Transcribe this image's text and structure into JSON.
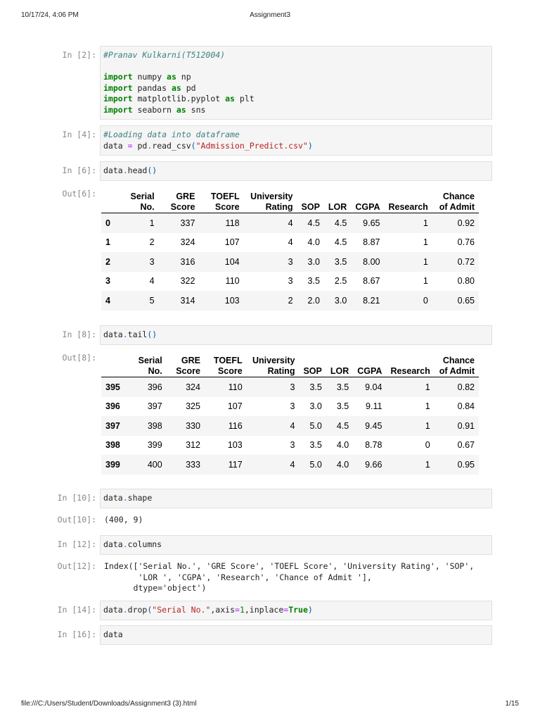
{
  "header": {
    "datetime": "10/17/24, 4:06 PM",
    "title": "Assignment3"
  },
  "footer": {
    "path": "file:///C:/Users/Student/Downloads/Assignment3 (3).html",
    "page": "1/15"
  },
  "cells": [
    {
      "prompt": "In [2]:",
      "code": [
        [
          [
            "#Pranav Kulkarni(T512004)",
            "cm"
          ]
        ],
        [],
        [
          [
            "import",
            "kw"
          ],
          [
            " numpy ",
            ""
          ],
          [
            "as",
            "kw"
          ],
          [
            " np",
            ""
          ]
        ],
        [
          [
            "import",
            "kw"
          ],
          [
            " pandas ",
            ""
          ],
          [
            "as",
            "kw"
          ],
          [
            " pd",
            ""
          ]
        ],
        [
          [
            "import",
            "kw"
          ],
          [
            " matplotlib.pyplot ",
            ""
          ],
          [
            "as",
            "kw"
          ],
          [
            " plt",
            ""
          ]
        ],
        [
          [
            "import",
            "kw"
          ],
          [
            " seaborn ",
            ""
          ],
          [
            "as",
            "kw"
          ],
          [
            " sns",
            ""
          ]
        ]
      ]
    },
    {
      "prompt": "In [4]:",
      "code": [
        [
          [
            "#Loading data into dataframe",
            "cm"
          ]
        ],
        [
          [
            "data ",
            ""
          ],
          [
            "=",
            "op"
          ],
          [
            " pd",
            ""
          ],
          [
            ".",
            "op"
          ],
          [
            "read_csv",
            ""
          ],
          [
            "(",
            "pn"
          ],
          [
            "\"Admission_Predict.csv\"",
            "st"
          ],
          [
            ")",
            "pn"
          ]
        ]
      ]
    },
    {
      "prompt": "In [6]:",
      "code": [
        [
          [
            "data",
            ""
          ],
          [
            ".",
            "op"
          ],
          [
            "head",
            ""
          ],
          [
            "()",
            "pn"
          ]
        ]
      ]
    },
    {
      "prompt": "In [8]:",
      "code": [
        [
          [
            "data",
            ""
          ],
          [
            ".",
            "op"
          ],
          [
            "tail",
            ""
          ],
          [
            "()",
            "pn"
          ]
        ]
      ]
    },
    {
      "prompt": "In [10]:",
      "code": [
        [
          [
            "data",
            ""
          ],
          [
            ".",
            "op"
          ],
          [
            "shape",
            ""
          ]
        ]
      ]
    },
    {
      "prompt": "In [12]:",
      "code": [
        [
          [
            "data",
            ""
          ],
          [
            ".",
            "op"
          ],
          [
            "columns",
            ""
          ]
        ]
      ]
    },
    {
      "prompt": "In [14]:",
      "code": [
        [
          [
            "data",
            ""
          ],
          [
            ".",
            "op"
          ],
          [
            "drop",
            ""
          ],
          [
            "(",
            "pn"
          ],
          [
            "\"Serial No.\"",
            "st"
          ],
          [
            ",axis",
            ""
          ],
          [
            "=",
            "op"
          ],
          [
            "1",
            "nu"
          ],
          [
            ",inplace",
            ""
          ],
          [
            "=",
            "op"
          ],
          [
            "True",
            "kw"
          ],
          [
            ")",
            "pn"
          ]
        ]
      ]
    },
    {
      "prompt": "In [16]:",
      "code": [
        [
          [
            "data",
            ""
          ]
        ]
      ]
    }
  ],
  "outputs": {
    "out6": {
      "prompt": "Out[6]:",
      "columns": [
        "",
        "Serial No.",
        "GRE Score",
        "TOEFL Score",
        "University Rating",
        "SOP",
        "LOR",
        "CGPA",
        "Research",
        "Chance of Admit"
      ],
      "rows": [
        [
          "0",
          "1",
          "337",
          "118",
          "4",
          "4.5",
          "4.5",
          "9.65",
          "1",
          "0.92"
        ],
        [
          "1",
          "2",
          "324",
          "107",
          "4",
          "4.0",
          "4.5",
          "8.87",
          "1",
          "0.76"
        ],
        [
          "2",
          "3",
          "316",
          "104",
          "3",
          "3.0",
          "3.5",
          "8.00",
          "1",
          "0.72"
        ],
        [
          "3",
          "4",
          "322",
          "110",
          "3",
          "3.5",
          "2.5",
          "8.67",
          "1",
          "0.80"
        ],
        [
          "4",
          "5",
          "314",
          "103",
          "2",
          "2.0",
          "3.0",
          "8.21",
          "0",
          "0.65"
        ]
      ]
    },
    "out8": {
      "prompt": "Out[8]:",
      "columns": [
        "",
        "Serial No.",
        "GRE Score",
        "TOEFL Score",
        "University Rating",
        "SOP",
        "LOR",
        "CGPA",
        "Research",
        "Chance of Admit"
      ],
      "rows": [
        [
          "395",
          "396",
          "324",
          "110",
          "3",
          "3.5",
          "3.5",
          "9.04",
          "1",
          "0.82"
        ],
        [
          "396",
          "397",
          "325",
          "107",
          "3",
          "3.0",
          "3.5",
          "9.11",
          "1",
          "0.84"
        ],
        [
          "397",
          "398",
          "330",
          "116",
          "4",
          "5.0",
          "4.5",
          "9.45",
          "1",
          "0.91"
        ],
        [
          "398",
          "399",
          "312",
          "103",
          "3",
          "3.5",
          "4.0",
          "8.78",
          "0",
          "0.67"
        ],
        [
          "399",
          "400",
          "333",
          "117",
          "4",
          "5.0",
          "4.0",
          "9.66",
          "1",
          "0.95"
        ]
      ]
    },
    "out10": {
      "prompt": "Out[10]:",
      "text": "(400, 9)"
    },
    "out12": {
      "prompt": "Out[12]:",
      "text": "Index(['Serial No.', 'GRE Score', 'TOEFL Score', 'University Rating', 'SOP',\n       'LOR ', 'CGPA', 'Research', 'Chance of Admit '],\n      dtype='object')"
    }
  }
}
